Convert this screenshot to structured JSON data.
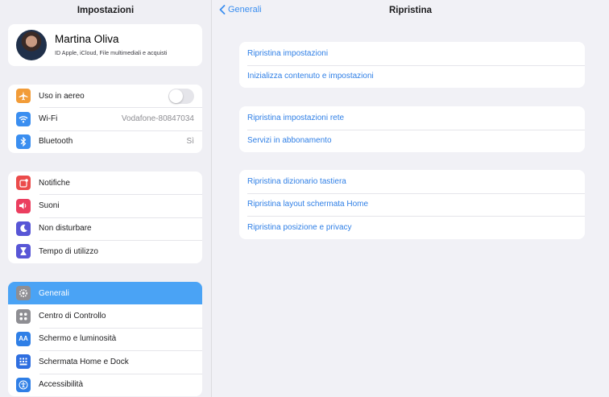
{
  "sidebar": {
    "title": "Impostazioni",
    "profile": {
      "name": "Martina Oliva",
      "subtitle": "ID Apple, iCloud, File multimediali e acquisti"
    },
    "group1": [
      {
        "label": "Uso in aereo",
        "icon": "airplane-icon",
        "color": "#f29c38",
        "toggle": "off"
      },
      {
        "label": "Wi-Fi",
        "value": "Vodafone-80847034",
        "icon": "wifi-icon",
        "color": "#3a8ef0"
      },
      {
        "label": "Bluetooth",
        "value": "Sì",
        "icon": "bluetooth-icon",
        "color": "#3a8ef0"
      }
    ],
    "group2": [
      {
        "label": "Notifiche",
        "icon": "notifications-icon",
        "color": "#eb4b4b"
      },
      {
        "label": "Suoni",
        "icon": "speaker-icon",
        "color": "#eb3e5f"
      },
      {
        "label": "Non disturbare",
        "icon": "moon-icon",
        "color": "#5856d6"
      },
      {
        "label": "Tempo di utilizzo",
        "icon": "hourglass-icon",
        "color": "#5856d6"
      }
    ],
    "group3": [
      {
        "label": "Generali",
        "icon": "gear-icon",
        "color": "#8e8e93",
        "selected": true
      },
      {
        "label": "Centro di Controllo",
        "icon": "control-center-icon",
        "color": "#8e8e93"
      },
      {
        "label": "Schermo e luminosità",
        "icon": "display-icon",
        "color": "#2f7fe6",
        "glyph": "AA"
      },
      {
        "label": "Schermata Home e Dock",
        "icon": "home-grid-icon",
        "color": "#2f6fe0"
      },
      {
        "label": "Accessibilità",
        "icon": "accessibility-icon",
        "color": "#2f7fe6"
      }
    ]
  },
  "main": {
    "back_label": "Generali",
    "title": "Ripristina",
    "groups": [
      [
        "Ripristina impostazioni",
        "Inizializza contenuto e impostazioni"
      ],
      [
        "Ripristina impostazioni rete",
        "Servizi in abbonamento"
      ],
      [
        "Ripristina dizionario tastiera",
        "Ripristina layout schermata Home",
        "Ripristina posizione e privacy"
      ]
    ]
  }
}
